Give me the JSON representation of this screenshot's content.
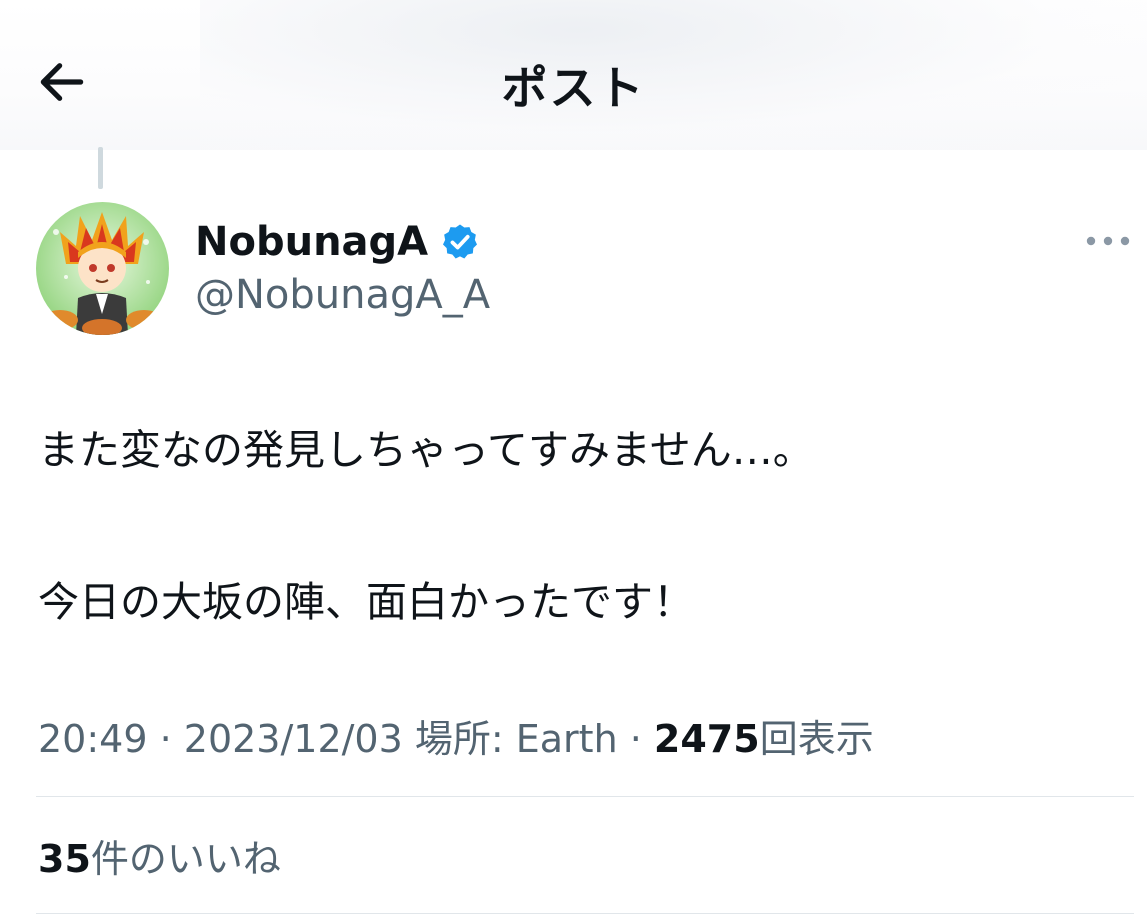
{
  "header": {
    "title": "ポスト",
    "back_icon": "arrow-left-icon"
  },
  "author": {
    "display_name": "NobunagA",
    "handle": "@NobunagA_A",
    "verified": true,
    "verified_color": "#1d9bf0",
    "avatar_icon": "anime-character-avatar"
  },
  "more_icon": "more-horizontal-icon",
  "post": {
    "lines": [
      "また変なの発見しちゃってすみません…。",
      "今日の大坂の陣、面白かったです！"
    ]
  },
  "meta": {
    "time": "20:49",
    "sep1": " · ",
    "date": "2023/12/03",
    "location_label": " 場所: ",
    "location": "Earth",
    "sep2": " · ",
    "views_count": "2475",
    "views_label": "回表示"
  },
  "likes": {
    "count": "35",
    "label": "件のいいね"
  },
  "colors": {
    "text_primary": "#0f1419",
    "text_secondary": "#536471",
    "divider": "#e1e6ea",
    "thread_line": "#cfd9de"
  }
}
